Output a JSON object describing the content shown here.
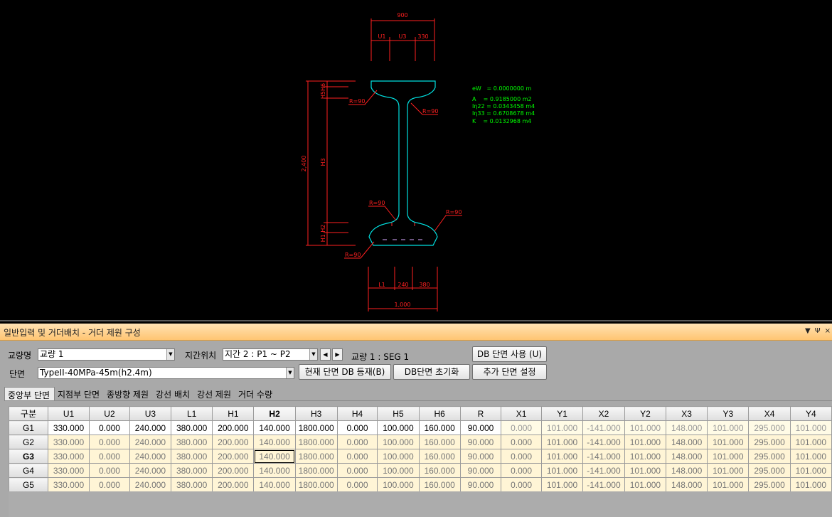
{
  "drawing": {
    "dims": {
      "top_width": "900",
      "top_parts": [
        "U1",
        "U3",
        "330"
      ],
      "bottom_parts": [
        "L1",
        "240",
        "380"
      ],
      "bottom_width": "1,000",
      "height": "2,400",
      "h_top_label": "H5H6",
      "h_mid_label": "H3",
      "h_bot_label": "H1 H2"
    },
    "radii": [
      "R=90",
      "R=90",
      "R=90",
      "R=90",
      "R=90"
    ],
    "props": [
      "eW   = 0.0000000 m",
      "A    = 0.9185000 m2",
      "Iη22 = 0.0343458 m4",
      "Iη33 = 0.6708678 m4",
      "K    = 0.0132968 m4"
    ],
    "colors": {
      "section": "#00e0e0",
      "dimension": "#ff2020",
      "props": "#00ff00"
    }
  },
  "panel": {
    "title": "일반입력 및 거더배치 - 거더 제원 구성",
    "window_buttons": [
      "▼",
      "Ψ",
      "×"
    ],
    "bridge_label": "교량명",
    "bridge_value": "교량 1",
    "span_label": "지간위치",
    "span_value": "지간 2 : P1 ~ P2",
    "seg_info": "교량 1 : SEG 1",
    "db_use_button": "DB 단면 사용 (U)",
    "section_label": "단면",
    "section_value": "TypeII-40MPa-45m(h2.4m)",
    "register_button": "현재 단면 DB 등재(B)",
    "reset_button": "DB단면 초기화",
    "add_button": "추가 단면 설정",
    "prev_icon": "◀",
    "next_icon": "▶"
  },
  "tabs": [
    "중앙부 단면",
    "지점부 단면",
    "종방향 제원",
    "강선 배치",
    "강선 제원",
    "거더 수량"
  ],
  "grid": {
    "headers": [
      "구분",
      "U1",
      "U2",
      "U3",
      "L1",
      "H1",
      "H2",
      "H3",
      "H4",
      "H5",
      "H6",
      "R",
      "X1",
      "Y1",
      "X2",
      "Y2",
      "X3",
      "Y3",
      "X4",
      "Y4"
    ],
    "rows": [
      {
        "name": "G1",
        "cells": [
          "330.000",
          "0.000",
          "240.000",
          "380.000",
          "200.000",
          "140.000",
          "1800.000",
          "0.000",
          "100.000",
          "160.000",
          "90.000",
          "0.000",
          "101.000",
          "-141.000",
          "101.000",
          "148.000",
          "101.000",
          "295.000",
          "101.000"
        ]
      },
      {
        "name": "G2",
        "cells": [
          "330.000",
          "0.000",
          "240.000",
          "380.000",
          "200.000",
          "140.000",
          "1800.000",
          "0.000",
          "100.000",
          "160.000",
          "90.000",
          "0.000",
          "101.000",
          "-141.000",
          "101.000",
          "148.000",
          "101.000",
          "295.000",
          "101.000"
        ]
      },
      {
        "name": "G3",
        "cells": [
          "330.000",
          "0.000",
          "240.000",
          "380.000",
          "200.000",
          "140.000",
          "1800.000",
          "0.000",
          "100.000",
          "160.000",
          "90.000",
          "0.000",
          "101.000",
          "-141.000",
          "101.000",
          "148.000",
          "101.000",
          "295.000",
          "101.000"
        ]
      },
      {
        "name": "G4",
        "cells": [
          "330.000",
          "0.000",
          "240.000",
          "380.000",
          "200.000",
          "140.000",
          "1800.000",
          "0.000",
          "100.000",
          "160.000",
          "90.000",
          "0.000",
          "101.000",
          "-141.000",
          "101.000",
          "148.000",
          "101.000",
          "295.000",
          "101.000"
        ]
      },
      {
        "name": "G5",
        "cells": [
          "330.000",
          "0.000",
          "240.000",
          "380.000",
          "200.000",
          "140.000",
          "1800.000",
          "0.000",
          "100.000",
          "160.000",
          "90.000",
          "0.000",
          "101.000",
          "-141.000",
          "101.000",
          "148.000",
          "101.000",
          "295.000",
          "101.000"
        ]
      }
    ]
  }
}
